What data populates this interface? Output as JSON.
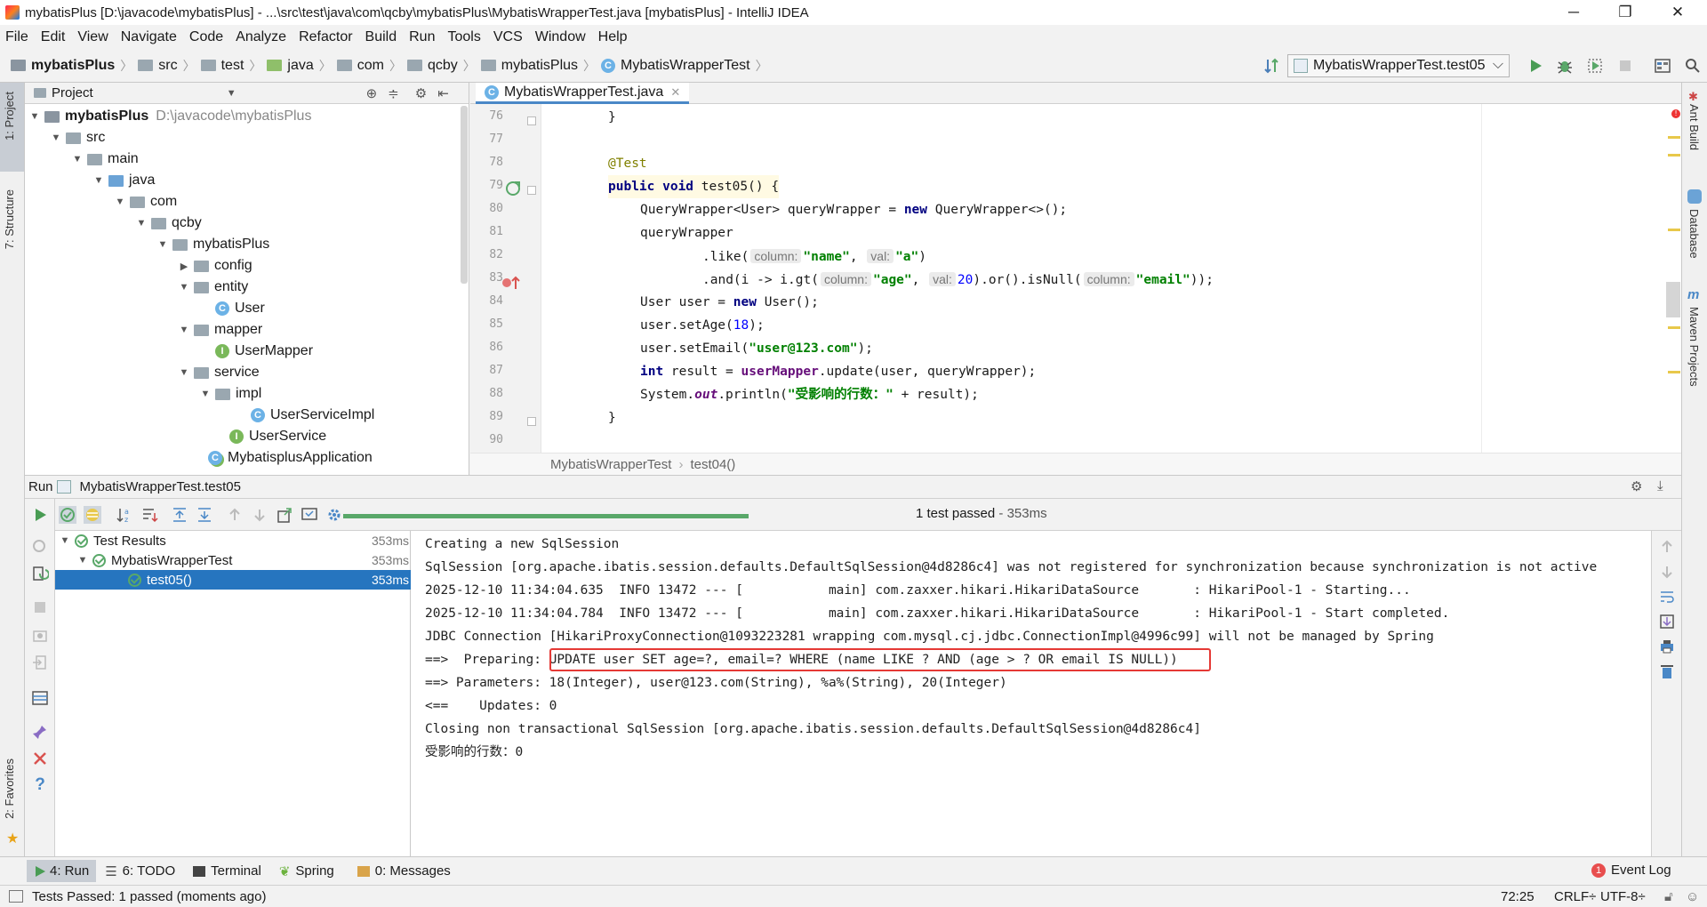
{
  "window": {
    "title": "mybatisPlus [D:\\javacode\\mybatisPlus] - ...\\src\\test\\java\\com\\qcby\\mybatisPlus\\MybatisWrapperTest.java [mybatisPlus] - IntelliJ IDEA",
    "controls": [
      "─",
      "❐",
      "✕"
    ]
  },
  "menu": [
    "File",
    "Edit",
    "View",
    "Navigate",
    "Code",
    "Analyze",
    "Refactor",
    "Build",
    "Run",
    "Tools",
    "VCS",
    "Window",
    "Help"
  ],
  "breadcrumbs": [
    "mybatisPlus",
    "src",
    "test",
    "java",
    "com",
    "qcby",
    "mybatisPlus",
    "MybatisWrapperTest"
  ],
  "run_config": "MybatisWrapperTest.test05",
  "left_tabs": {
    "project": "1: Project",
    "structure": "7: Structure",
    "favorites": "2: Favorites"
  },
  "right_tabs": {
    "ant": "Ant Build",
    "database": "Database",
    "maven": "Maven Projects"
  },
  "project": {
    "header": "Project",
    "tree": [
      {
        "label": "mybatisPlus",
        "extra": "D:\\javacode\\mybatisPlus",
        "kind": "module"
      },
      {
        "label": "src",
        "kind": "folder"
      },
      {
        "label": "main",
        "kind": "folder"
      },
      {
        "label": "java",
        "kind": "source"
      },
      {
        "label": "com",
        "kind": "package"
      },
      {
        "label": "qcby",
        "kind": "package"
      },
      {
        "label": "mybatisPlus",
        "kind": "package"
      },
      {
        "label": "config",
        "kind": "package"
      },
      {
        "label": "entity",
        "kind": "package"
      },
      {
        "label": "User",
        "kind": "class"
      },
      {
        "label": "mapper",
        "kind": "package"
      },
      {
        "label": "UserMapper",
        "kind": "interface"
      },
      {
        "label": "service",
        "kind": "package"
      },
      {
        "label": "impl",
        "kind": "package"
      },
      {
        "label": "UserServiceImpl",
        "kind": "class"
      },
      {
        "label": "UserService",
        "kind": "interface"
      },
      {
        "label": "MybatisplusApplication",
        "kind": "springclass"
      }
    ]
  },
  "editor": {
    "tab": "MybatisWrapperTest.java",
    "line_numbers": [
      "76",
      "77",
      "78",
      "79",
      "80",
      "81",
      "82",
      "83",
      "84",
      "85",
      "86",
      "87",
      "88",
      "89",
      "90"
    ],
    "breadcrumb": [
      "MybatisWrapperTest",
      "test04()"
    ],
    "code": {
      "l76": "}",
      "l78": "@Test",
      "l79_kw": "public void",
      "l79_rest": " test05() {",
      "l80_a": "QueryWrapper<User> queryWrapper = ",
      "l80_kw": "new",
      "l80_b": " QueryWrapper<>();",
      "l81": "queryWrapper",
      "l82_a": ".like(",
      "l82_h1": "column:",
      "l82_s1": "\"name\"",
      "l82_c": ", ",
      "l82_h2": "val:",
      "l82_s2": "\"a\"",
      "l82_e": ")",
      "l83_a": ".and(i -> i.gt(",
      "l83_h1": "column:",
      "l83_s1": "\"age\"",
      "l83_c": ", ",
      "l83_h2": "val:",
      "l83_n": "20",
      "l83_b": ").or().isNull(",
      "l83_h3": "column:",
      "l83_s3": "\"email\"",
      "l83_e": "));",
      "l84_a": "User user = ",
      "l84_kw": "new",
      "l84_b": " User();",
      "l85_a": "user.setAge(",
      "l85_n": "18",
      "l85_b": ");",
      "l86_a": "user.setEmail(",
      "l86_s": "\"user@123.com\"",
      "l86_b": ");",
      "l87_kw": "int",
      "l87_a": " result = ",
      "l87_f": "userMapper",
      "l87_b": ".update(user, queryWrapper);",
      "l88_a": "System.",
      "l88_f": "out",
      "l88_b": ".println(",
      "l88_s": "\"受影响的行数：\"",
      "l88_c": " + result);",
      "l89": "}"
    }
  },
  "run": {
    "header_label": "Run",
    "header_config": "MybatisWrapperTest.test05",
    "status": "1 test passed",
    "status_time": " - 353ms",
    "progress": 1.0,
    "tree": [
      {
        "label": "Test Results",
        "time": "353ms"
      },
      {
        "label": "MybatisWrapperTest",
        "time": "353ms"
      },
      {
        "label": "test05()",
        "time": "353ms"
      }
    ],
    "console": [
      "Creating a new SqlSession",
      "SqlSession [org.apache.ibatis.session.defaults.DefaultSqlSession@4d8286c4] was not registered for synchronization because synchronization is not active",
      "2025-12-10 11:34:04.635  INFO 13472 --- [           main] com.zaxxer.hikari.HikariDataSource       : HikariPool-1 - Starting...",
      "2025-12-10 11:34:04.784  INFO 13472 --- [           main] com.zaxxer.hikari.HikariDataSource       : HikariPool-1 - Start completed.",
      "JDBC Connection [HikariProxyConnection@1093223281 wrapping com.mysql.cj.jdbc.ConnectionImpl@4996c99] will not be managed by Spring",
      "==>  Preparing: UPDATE user SET age=?, email=? WHERE (name LIKE ? AND (age > ? OR email IS NULL))",
      "==> Parameters: 18(Integer), user@123.com(String), %a%(String), 20(Integer)",
      "<==    Updates: 0",
      "Closing non transactional SqlSession [org.apache.ibatis.session.defaults.DefaultSqlSession@4d8286c4]",
      "受影响的行数：0"
    ]
  },
  "bottom_tabs": [
    {
      "label": "4: Run"
    },
    {
      "label": "6: TODO"
    },
    {
      "label": "Terminal"
    },
    {
      "label": "Spring"
    },
    {
      "label": "0: Messages"
    }
  ],
  "event_log": {
    "count": "1",
    "label": "Event Log"
  },
  "statusbar": {
    "message": "Tests Passed: 1 passed (moments ago)",
    "position": "72:25",
    "line_sep": "CRLF÷",
    "encoding": "UTF-8÷"
  }
}
